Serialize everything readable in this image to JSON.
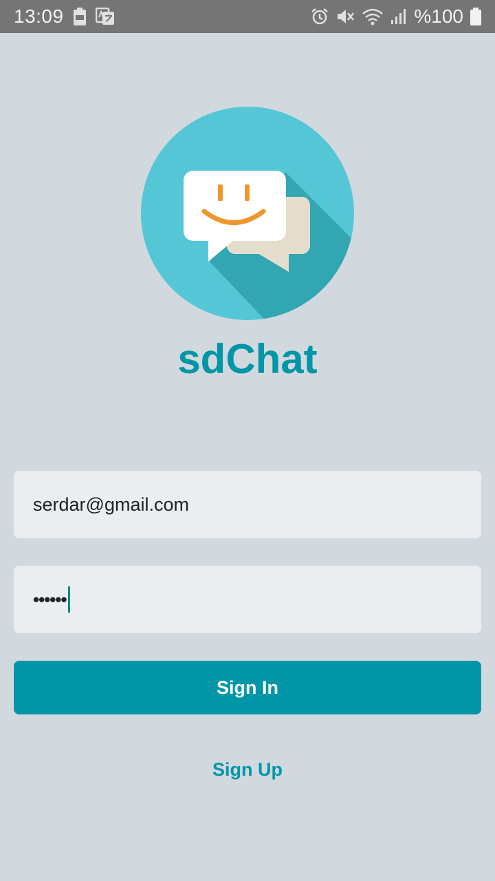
{
  "status_bar": {
    "time": "13:09",
    "battery_percent": "%100",
    "icons": [
      "battery-saver-icon",
      "translate-icon",
      "alarm-icon",
      "mute-icon",
      "wifi-icon",
      "signal-icon",
      "battery-icon"
    ]
  },
  "app": {
    "title": "sdChat",
    "logo": "chat-bubbles-logo"
  },
  "form": {
    "email_value": "serdar@gmail.com",
    "password_masked": "••••••",
    "signin_label": "Sign In",
    "signup_label": "Sign Up"
  },
  "colors": {
    "background": "#d1d9df",
    "accent": "#0096a8",
    "status_bar": "#757575",
    "logo_circle": "#55c6d6",
    "smile": "#f0962e"
  }
}
